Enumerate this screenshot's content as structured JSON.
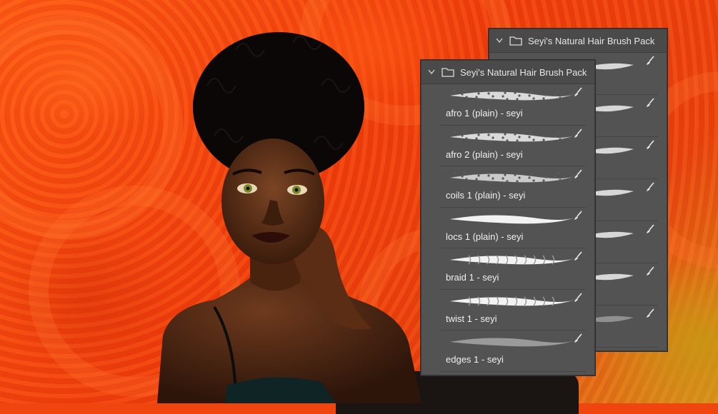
{
  "panels": {
    "back": {
      "title": "Seyi's Natural Hair Brush Pack",
      "item_count": 7
    },
    "front": {
      "title": "Seyi's Natural Hair Brush Pack",
      "brushes": [
        {
          "label": "afro 1 (plain) - seyi",
          "style": "afro"
        },
        {
          "label": "afro 2 (plain) - seyi",
          "style": "afro2"
        },
        {
          "label": "coils 1 (plain) - seyi",
          "style": "coils"
        },
        {
          "label": "locs 1 (plain) - seyi",
          "style": "locs"
        },
        {
          "label": "braid 1 - seyi",
          "style": "braid"
        },
        {
          "label": "twist 1 - seyi",
          "style": "twist"
        },
        {
          "label": "edges 1 - seyi",
          "style": "edges"
        }
      ]
    }
  },
  "icons": {
    "collapse": "chevron-down-icon",
    "group": "folder-icon",
    "brush": "brush-icon"
  },
  "colors": {
    "background": "#f0450f",
    "panel": "#535353",
    "panel_text": "#f0f0f0"
  }
}
